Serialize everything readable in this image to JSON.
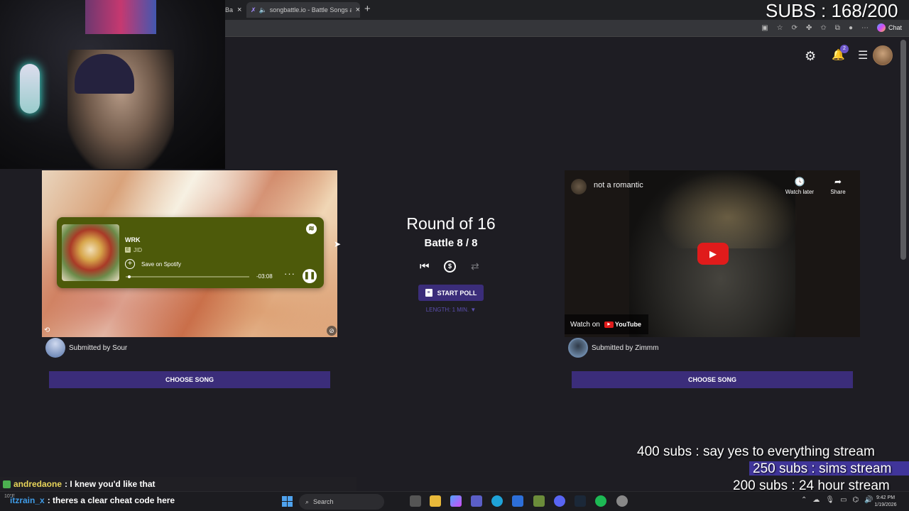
{
  "overlay": {
    "subs_goal": "SUBS : 168/200",
    "goal_400": "400 subs :  say yes to everything stream",
    "goal_250": "250 subs : sims stream",
    "goal_200": "200 subs : 24 hour stream"
  },
  "browser": {
    "tab1_label": "Ba",
    "tab2_label": "songbattle.io - Battle Songs a",
    "tab_close": "×",
    "new_tab": "+",
    "chat_label": "Chat"
  },
  "page": {
    "notification_count": "2",
    "round_title": "Round of 16",
    "battle_label": "Battle 8 / 8",
    "start_poll": "START POLL",
    "poll_length": "LENGTH: 1 MIN. ▼",
    "choose_song": "CHOOSE SONG"
  },
  "left_song": {
    "track": "WRK",
    "explicit_badge": "E",
    "artist": "JID",
    "save_label": "Save on Spotify",
    "time_remaining": "-03:08",
    "progress": 0.02,
    "submitted_by": "Submitted by Sour"
  },
  "right_song": {
    "video_title": "not a romantic",
    "watch_later": "Watch later",
    "share": "Share",
    "watch_on": "Watch on",
    "youtube_label": "YouTube",
    "submitted_by": "Submitted by Zimmm"
  },
  "chat": [
    {
      "user": "andredaone",
      "message": ": I knew you'd like that"
    },
    {
      "user": "itzrain_x",
      "message": ": theres a clear cheat code here"
    }
  ],
  "taskbar": {
    "weather": "10°F",
    "search_placeholder": "Search",
    "time": "9:42 PM",
    "date": "1/19/2026"
  },
  "colors": {
    "accent_purple": "#3b2d7a",
    "spotify_widget": "#4d5a0a",
    "youtube_red": "#e01b1b"
  }
}
